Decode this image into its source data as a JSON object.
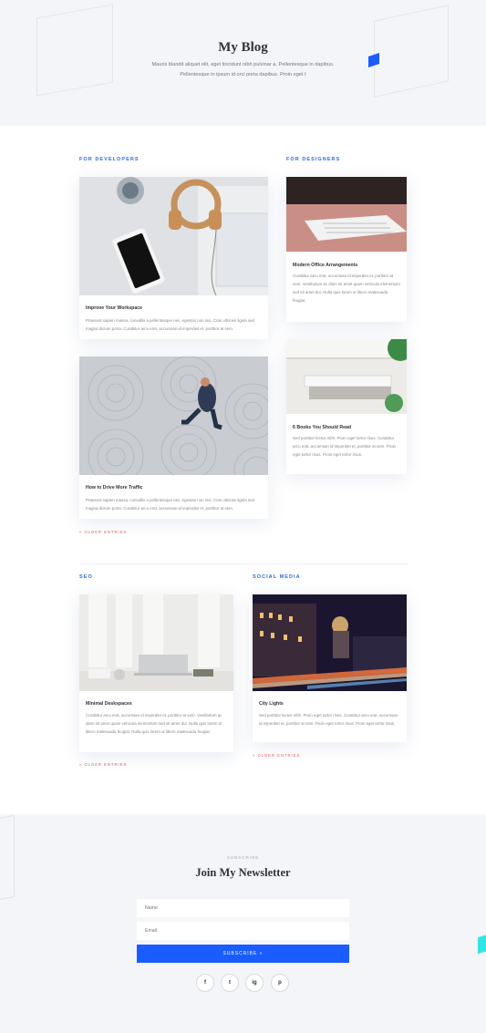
{
  "hero": {
    "title": "My Blog",
    "subtitle_line1": "Mauris blandit aliquet elit, eget tincidunt nibh pulvinar a. Pellentesque in dapibus.",
    "subtitle_line2": "Pellentesque in ipsum id orci porta dapibus. Proin eget t"
  },
  "sections": {
    "developers": {
      "heading": "FOR DEVELOPERS",
      "posts": [
        {
          "title": "Improve Your Workspace",
          "excerpt": "Praesent sapien massa, convallis a pellentesque nec, egestas non nisi. Cras ultricies ligula sed magna dictum porta. Curabitur arcu erat, accumsan id imperdiet et, porttitor at sem."
        },
        {
          "title": "How to Drive More Traffic",
          "excerpt": "Praesent sapien massa, convallis a pellentesque nec, egestas non nisi. Cras ultricies ligula sed magna dictum porta. Curabitur arcu erat, accumsan id imperdiet et, porttitor at sem."
        }
      ],
      "older": "« OLDER ENTRIES"
    },
    "designers": {
      "heading": "FOR DESIGNERS",
      "posts": [
        {
          "title": "Modern Office Arrangements",
          "excerpt": "Curabitur arcu erat, accumsan id imperdiet et, porttitor at sem. Vestibulum ac diam sit amet quam vehicula elementum sed sit amet dui. Nulla quis lorem ut libero malesuada feugiat."
        },
        {
          "title": "6 Books You Should Read",
          "excerpt": "Sed porttitor lectus nibh. Proin eget tortor risus. Curabitur arcu erat, accumsan id imperdiet et, porttitor at sem. Proin eget tortor risus. Proin eget tortor risus."
        }
      ]
    },
    "seo": {
      "heading": "SEO",
      "posts": [
        {
          "title": "Minimal Deskspaces",
          "excerpt": "Curabitur arcu erat, accumsan id imperdiet et, porttitor at sem. Vestibulum ac diam sit amet quam vehicula elementum sed sit amet dui. Nulla quis lorem ut libero malesuada feugiat. Nulla quis lorem ut libero malesuada feugiat."
        }
      ],
      "older": "« OLDER ENTRIES"
    },
    "social": {
      "heading": "SOCIAL MEDIA",
      "posts": [
        {
          "title": "City Lights",
          "excerpt": "Sed porttitor lectus nibh. Proin eget tortor risus. Curabitur arcu erat, accumsan id imperdiet et, porttitor at sem. Proin eget tortor risus. Proin eget tortor risus."
        }
      ],
      "older": "« OLDER ENTRIES"
    }
  },
  "newsletter": {
    "kicker": "SUBSCRIBE",
    "title": "Join My Newsletter",
    "name_placeholder": "Name",
    "email_placeholder": "Email",
    "button": "SUBSCRIBE »",
    "social": [
      "f",
      "t",
      "ig",
      "p"
    ]
  },
  "colors": {
    "accent": "#1a5cff",
    "category": "#2e6ae6",
    "older_link": "#e05a5a",
    "teal": "#2ee6e6"
  }
}
